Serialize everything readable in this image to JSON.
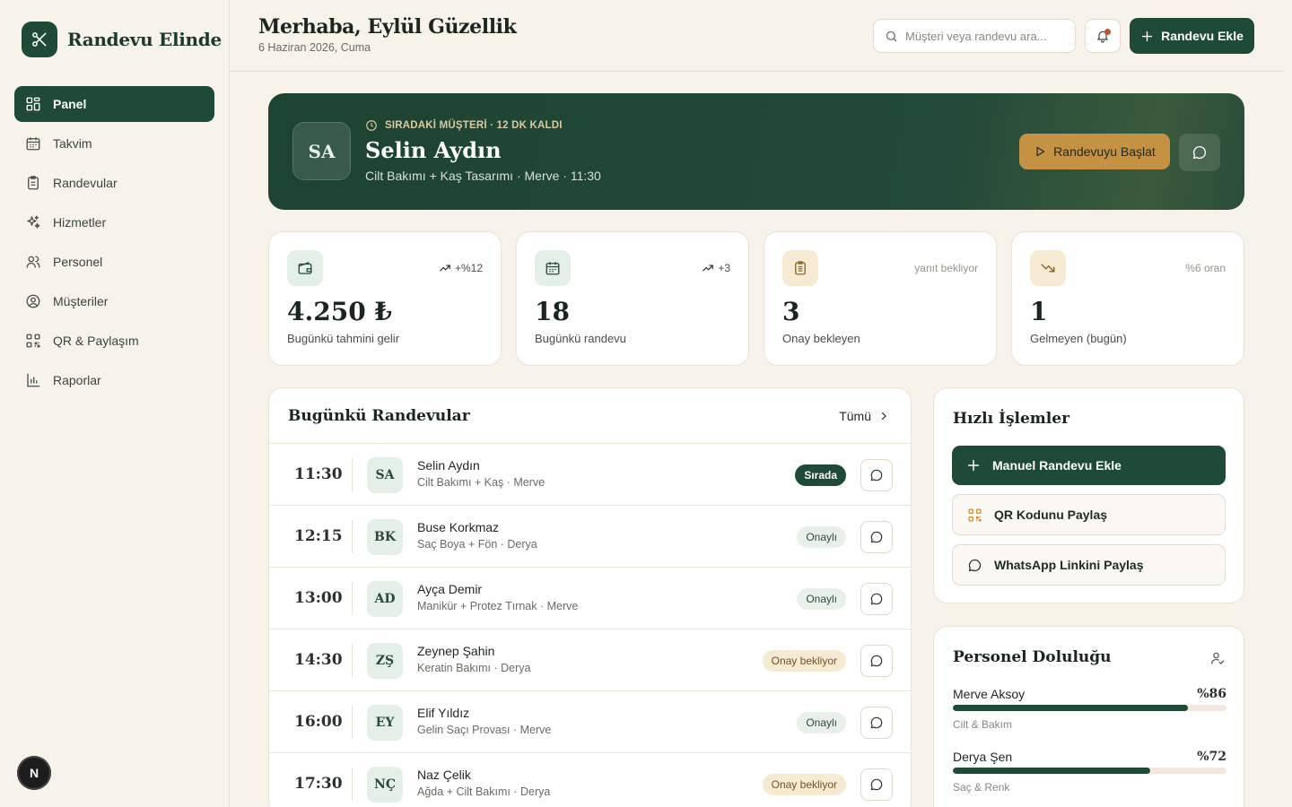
{
  "brand": {
    "name": "Randevu Elinde",
    "logo_icon": "scissors-icon"
  },
  "sidebar": {
    "items": [
      {
        "label": "Panel",
        "icon": "dashboard-icon",
        "active": true
      },
      {
        "label": "Takvim",
        "icon": "calendar-icon"
      },
      {
        "label": "Randevular",
        "icon": "clipboard-icon"
      },
      {
        "label": "Hizmetler",
        "icon": "sparkles-icon"
      },
      {
        "label": "Personel",
        "icon": "users-icon"
      },
      {
        "label": "Müşteriler",
        "icon": "user-circle-icon"
      },
      {
        "label": "QR & Paylaşım",
        "icon": "qr-icon"
      },
      {
        "label": "Raporlar",
        "icon": "bar-chart-icon"
      }
    ],
    "user_avatar": "N"
  },
  "header": {
    "greeting": "Merhaba, Eylül Güzellik",
    "date": "6 Haziran 2026, Cuma",
    "search_placeholder": "Müşteri veya randevu ara...",
    "add_button": "Randevu Ekle"
  },
  "hero": {
    "initials": "SA",
    "tag": "SIRADAKİ MÜŞTERİ · 12 DK KALDI",
    "name": "Selin Aydın",
    "detail": "Cilt Bakımı + Kaş Tasarımı · Merve · 11:30",
    "start_button": "Randevuyu Başlat"
  },
  "stats": [
    {
      "value": "4.250 ₺",
      "label": "Bugünkü tahmini gelir",
      "trend": "+%12",
      "icon": "wallet-icon",
      "icon_bg": "#e4efe8"
    },
    {
      "value": "18",
      "label": "Bugünkü randevu",
      "trend": "+3",
      "icon": "calendar-icon",
      "icon_bg": "#e4efe8"
    },
    {
      "value": "3",
      "label": "Onay bekleyen",
      "trend": "yanıt bekliyor",
      "icon": "clipboard-icon",
      "icon_bg": "#f6ead2"
    },
    {
      "value": "1",
      "label": "Gelmeyen (bugün)",
      "trend": "%6 oran",
      "icon": "trending-down-icon",
      "icon_bg": "#f6ead2"
    }
  ],
  "appointments": {
    "title": "Bugünkü Randevular",
    "all_link": "Tümü",
    "rows": [
      {
        "time": "11:30",
        "initials": "SA",
        "name": "Selin Aydın",
        "sub": "Cilt Bakımı + Kaş · Merve",
        "status": "Sırada",
        "kind": "next"
      },
      {
        "time": "12:15",
        "initials": "BK",
        "name": "Buse Korkmaz",
        "sub": "Saç Boya + Fön · Derya",
        "status": "Onaylı",
        "kind": "ok"
      },
      {
        "time": "13:00",
        "initials": "AD",
        "name": "Ayça Demir",
        "sub": "Manikür + Protez Tırnak · Merve",
        "status": "Onaylı",
        "kind": "ok"
      },
      {
        "time": "14:30",
        "initials": "ZŞ",
        "name": "Zeynep Şahin",
        "sub": "Keratin Bakımı · Derya",
        "status": "Onay bekliyor",
        "kind": "wait"
      },
      {
        "time": "16:00",
        "initials": "EY",
        "name": "Elif Yıldız",
        "sub": "Gelin Saçı Provası · Merve",
        "status": "Onaylı",
        "kind": "ok"
      },
      {
        "time": "17:30",
        "initials": "NÇ",
        "name": "Naz Çelik",
        "sub": "Ağda + Cilt Bakımı · Derya",
        "status": "Onay bekliyor",
        "kind": "wait"
      }
    ]
  },
  "quick_actions": {
    "title": "Hızlı İşlemler",
    "items": [
      {
        "label": "Manuel Randevu Ekle",
        "icon": "plus-icon"
      },
      {
        "label": "QR Kodunu Paylaş",
        "icon": "qr-icon"
      },
      {
        "label": "WhatsApp Linkini Paylaş",
        "icon": "chat-icon"
      }
    ]
  },
  "staff": {
    "title": "Personel Doluluğu",
    "members": [
      {
        "name": "Merve Aksoy",
        "pct_label": "%86",
        "pct": 86,
        "role": "Cilt & Bakım"
      },
      {
        "name": "Derya Şen",
        "pct_label": "%72",
        "pct": 72,
        "role": "Saç & Renk"
      }
    ]
  },
  "colors": {
    "primary": "#1f4a37",
    "accent": "#c39243",
    "background": "#f7f2ea"
  }
}
